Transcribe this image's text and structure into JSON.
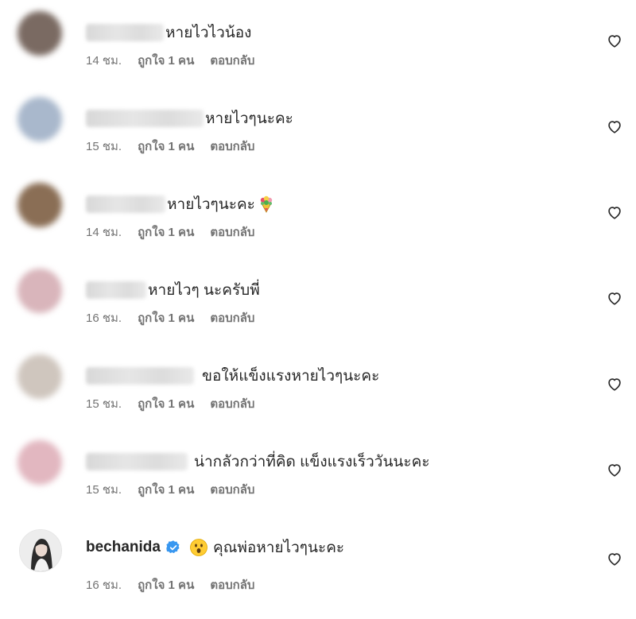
{
  "comments": [
    {
      "text": "หายไวไวน้อง",
      "time": "14 ชม.",
      "likes": "ถูกใจ 1 คน",
      "reply": "ตอบกลับ",
      "avatar_color": "#7a6a62"
    },
    {
      "text": "หายไวๆนะคะ",
      "time": "15 ชม.",
      "likes": "ถูกใจ 1 คน",
      "reply": "ตอบกลับ",
      "avatar_color": "#a9b8cc"
    },
    {
      "text": "หายไวๆนะคะ",
      "time": "14 ชม.",
      "likes": "ถูกใจ 1 คน",
      "reply": "ตอบกลับ",
      "avatar_color": "#8a6e55",
      "emoji": "bouquet-icon"
    },
    {
      "text": "หายไวๆ นะครับพี่",
      "time": "16 ชม.",
      "likes": "ถูกใจ 1 คน",
      "reply": "ตอบกลับ",
      "avatar_color": "#d9b5bb"
    },
    {
      "text": "ขอให้แข็งแรงหายไวๆนะคะ",
      "time": "15 ชม.",
      "likes": "ถูกใจ 1 คน",
      "reply": "ตอบกลับ",
      "avatar_color": "#cfc6be"
    },
    {
      "text": "น่ากลัวกว่าที่คิด แข็งแรงเร็ววันนะคะ",
      "time": "15 ชม.",
      "likes": "ถูกใจ 1 คน",
      "reply": "ตอบกลับ",
      "avatar_color": "#e2b7c0"
    },
    {
      "username": "bechanida",
      "text": "คุณพ่อหายไวๆนะคะ",
      "time": "16 ชม.",
      "likes": "ถูกใจ 1 คน",
      "reply": "ตอบกลับ",
      "verified": true,
      "emoji": "astonished-face-icon",
      "verified_color": "#3897f0"
    }
  ],
  "colors": {
    "text": "#262626",
    "secondary": "#737373"
  }
}
